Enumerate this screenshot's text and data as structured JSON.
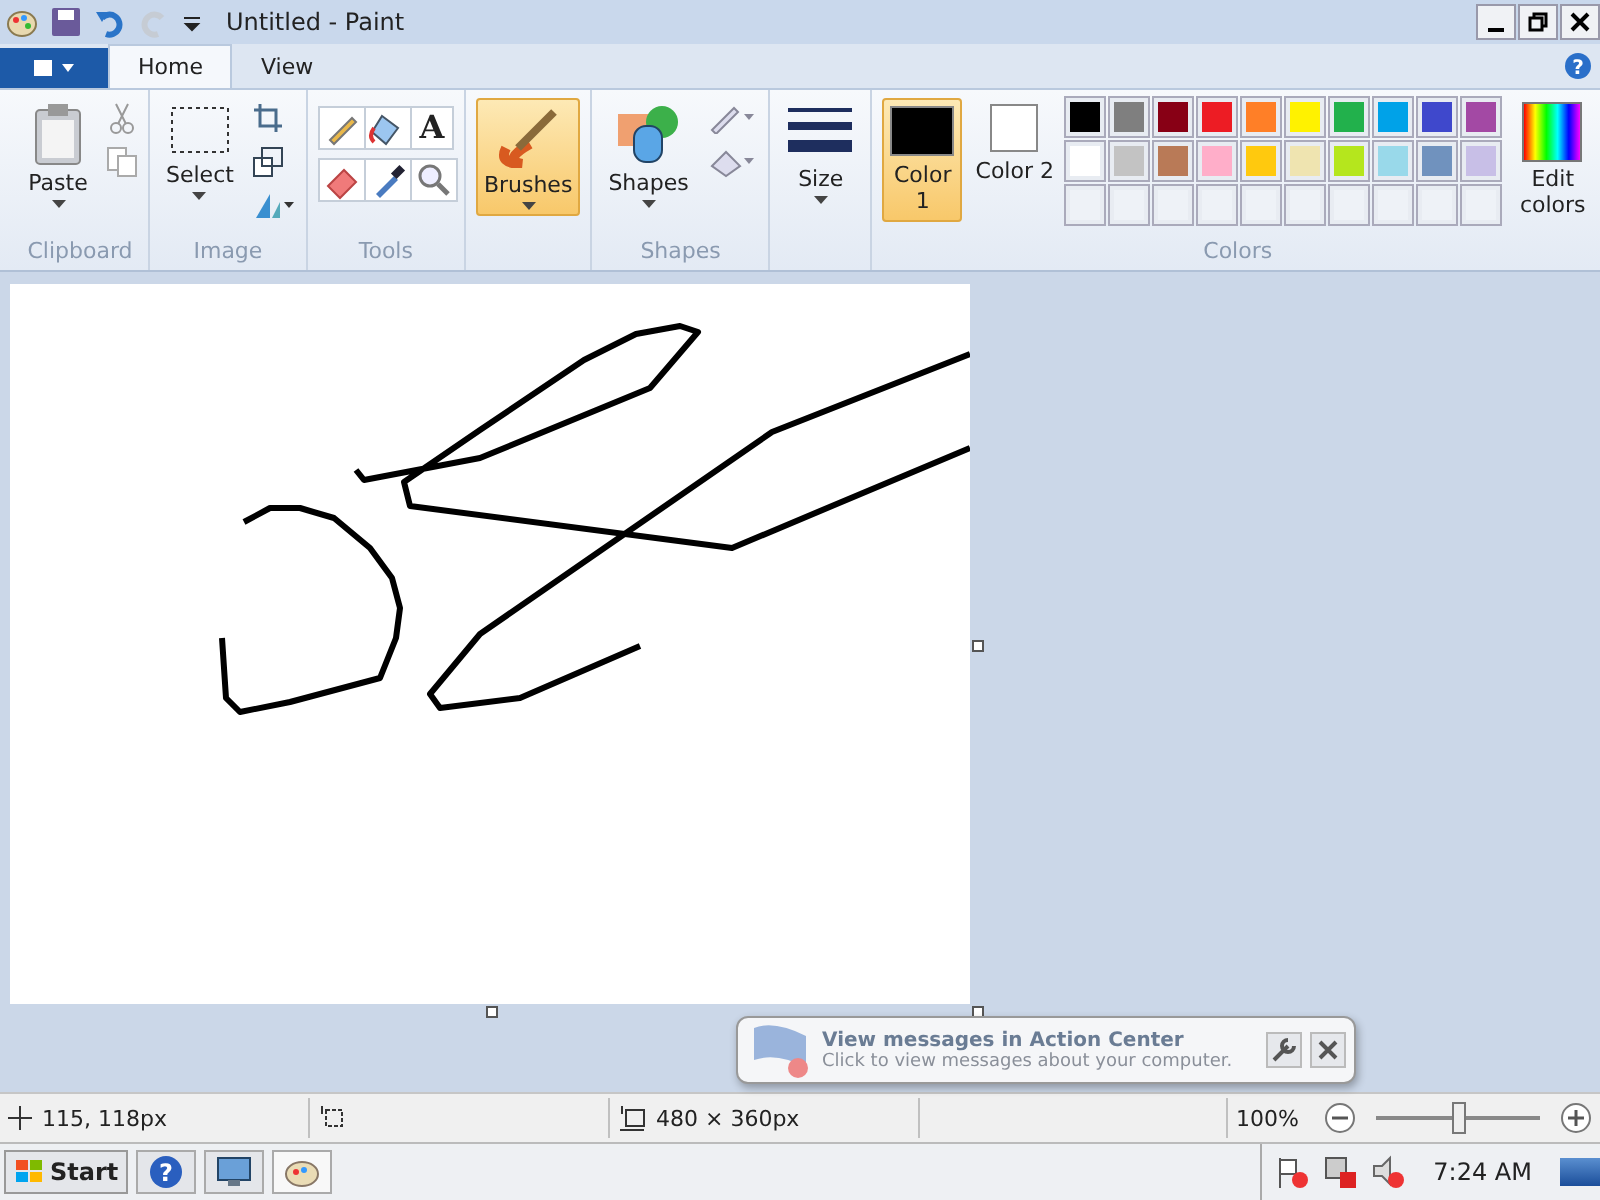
{
  "window": {
    "title": "Untitled - Paint"
  },
  "help_glyph": "?",
  "tabs": [
    {
      "label": "Home",
      "selected": true
    },
    {
      "label": "View",
      "selected": false
    }
  ],
  "ribbon": {
    "clipboard": {
      "paste": "Paste",
      "group": "Clipboard"
    },
    "image": {
      "select": "Select",
      "group": "Image"
    },
    "tools": {
      "group": "Tools",
      "text_tool": "A"
    },
    "brushes": {
      "label": "Brushes",
      "selected": true
    },
    "shapes": {
      "label": "Shapes",
      "group": "Shapes"
    },
    "size": {
      "label": "Size"
    },
    "colors": {
      "group": "Colors",
      "edit": "Edit colors",
      "slots": [
        {
          "label": "Color 1",
          "color": "#000000",
          "selected": true
        },
        {
          "label": "Color 2",
          "color": "#ffffff",
          "selected": false
        }
      ],
      "palette": [
        {
          "color": "#000000"
        },
        {
          "color": "#7f7f7f"
        },
        {
          "color": "#880015"
        },
        {
          "color": "#ed1c24"
        },
        {
          "color": "#ff7f27"
        },
        {
          "color": "#fff200"
        },
        {
          "color": "#22b14c"
        },
        {
          "color": "#00a2e8"
        },
        {
          "color": "#3f48cc"
        },
        {
          "color": "#a349a4"
        },
        {
          "color": "#ffffff"
        },
        {
          "color": "#c3c3c3"
        },
        {
          "color": "#b97a57"
        },
        {
          "color": "#ffaec9"
        },
        {
          "color": "#ffc90e"
        },
        {
          "color": "#efe4b0"
        },
        {
          "color": "#b5e61d"
        },
        {
          "color": "#99d9ea"
        },
        {
          "color": "#7092be"
        },
        {
          "color": "#c8bfe7"
        }
      ]
    }
  },
  "status_bar": {
    "cursor": "115, 118px",
    "image_size": "480 × 360px",
    "zoom": "100%",
    "zoom_level": {
      "level": 0.5
    }
  },
  "notification": {
    "title": "View messages in Action Center",
    "text": "Click to view messages about your computer."
  },
  "taskbar": {
    "start": "Start",
    "help_glyph": "?",
    "time": "7:24 AM"
  }
}
